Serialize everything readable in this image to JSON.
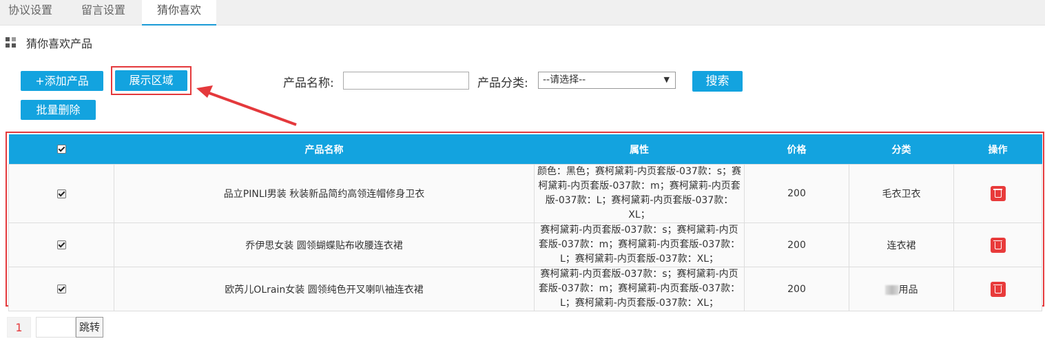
{
  "tabs": [
    {
      "label": "协议设置",
      "active": false
    },
    {
      "label": "留言设置",
      "active": false
    },
    {
      "label": "猜你喜欢",
      "active": true
    }
  ],
  "section": {
    "title": "猜你喜欢产品",
    "icon": "grid-icon"
  },
  "toolbar": {
    "add_label": "+添加产品",
    "area_label": "展示区域",
    "batch_delete_label": "批量删除",
    "name_label": "产品名称:",
    "name_value": "",
    "category_label": "产品分类:",
    "category_selected": "--请选择--",
    "search_label": "搜索"
  },
  "table": {
    "headers": [
      "产品名称",
      "属性",
      "价格",
      "分类",
      "操作"
    ],
    "rows": [
      {
        "checked": true,
        "name": "品立PINLI男装 秋装新品简约高领连帽修身卫衣",
        "attr": "颜色：黑色；赛柯黛莉-内页套版-037款：s；赛柯黛莉-内页套版-037款：m；赛柯黛莉-内页套版-037款：L；赛柯黛莉-内页套版-037款：XL；",
        "price": "200",
        "category": "毛衣卫衣"
      },
      {
        "checked": true,
        "name": "乔伊思女装 圆领蝴蝶贴布收腰连衣裙",
        "attr": "赛柯黛莉-内页套版-037款：s；赛柯黛莉-内页套版-037款：m；赛柯黛莉-内页套版-037款：L；赛柯黛莉-内页套版-037款：XL；",
        "price": "200",
        "category": "连衣裙"
      },
      {
        "checked": true,
        "name": "欧芮儿OLrain女装 圆领纯色开叉喇叭袖连衣裙",
        "attr": "赛柯黛莉-内页套版-037款：s；赛柯黛莉-内页套版-037款：m；赛柯黛莉-内页套版-037款：L；赛柯黛莉-内页套版-037款：XL；",
        "price": "200",
        "category": "用品"
      }
    ]
  },
  "pager": {
    "current": "1",
    "go_label": "跳转"
  },
  "colors": {
    "accent": "#13a3df",
    "highlight": "#e4393c"
  }
}
